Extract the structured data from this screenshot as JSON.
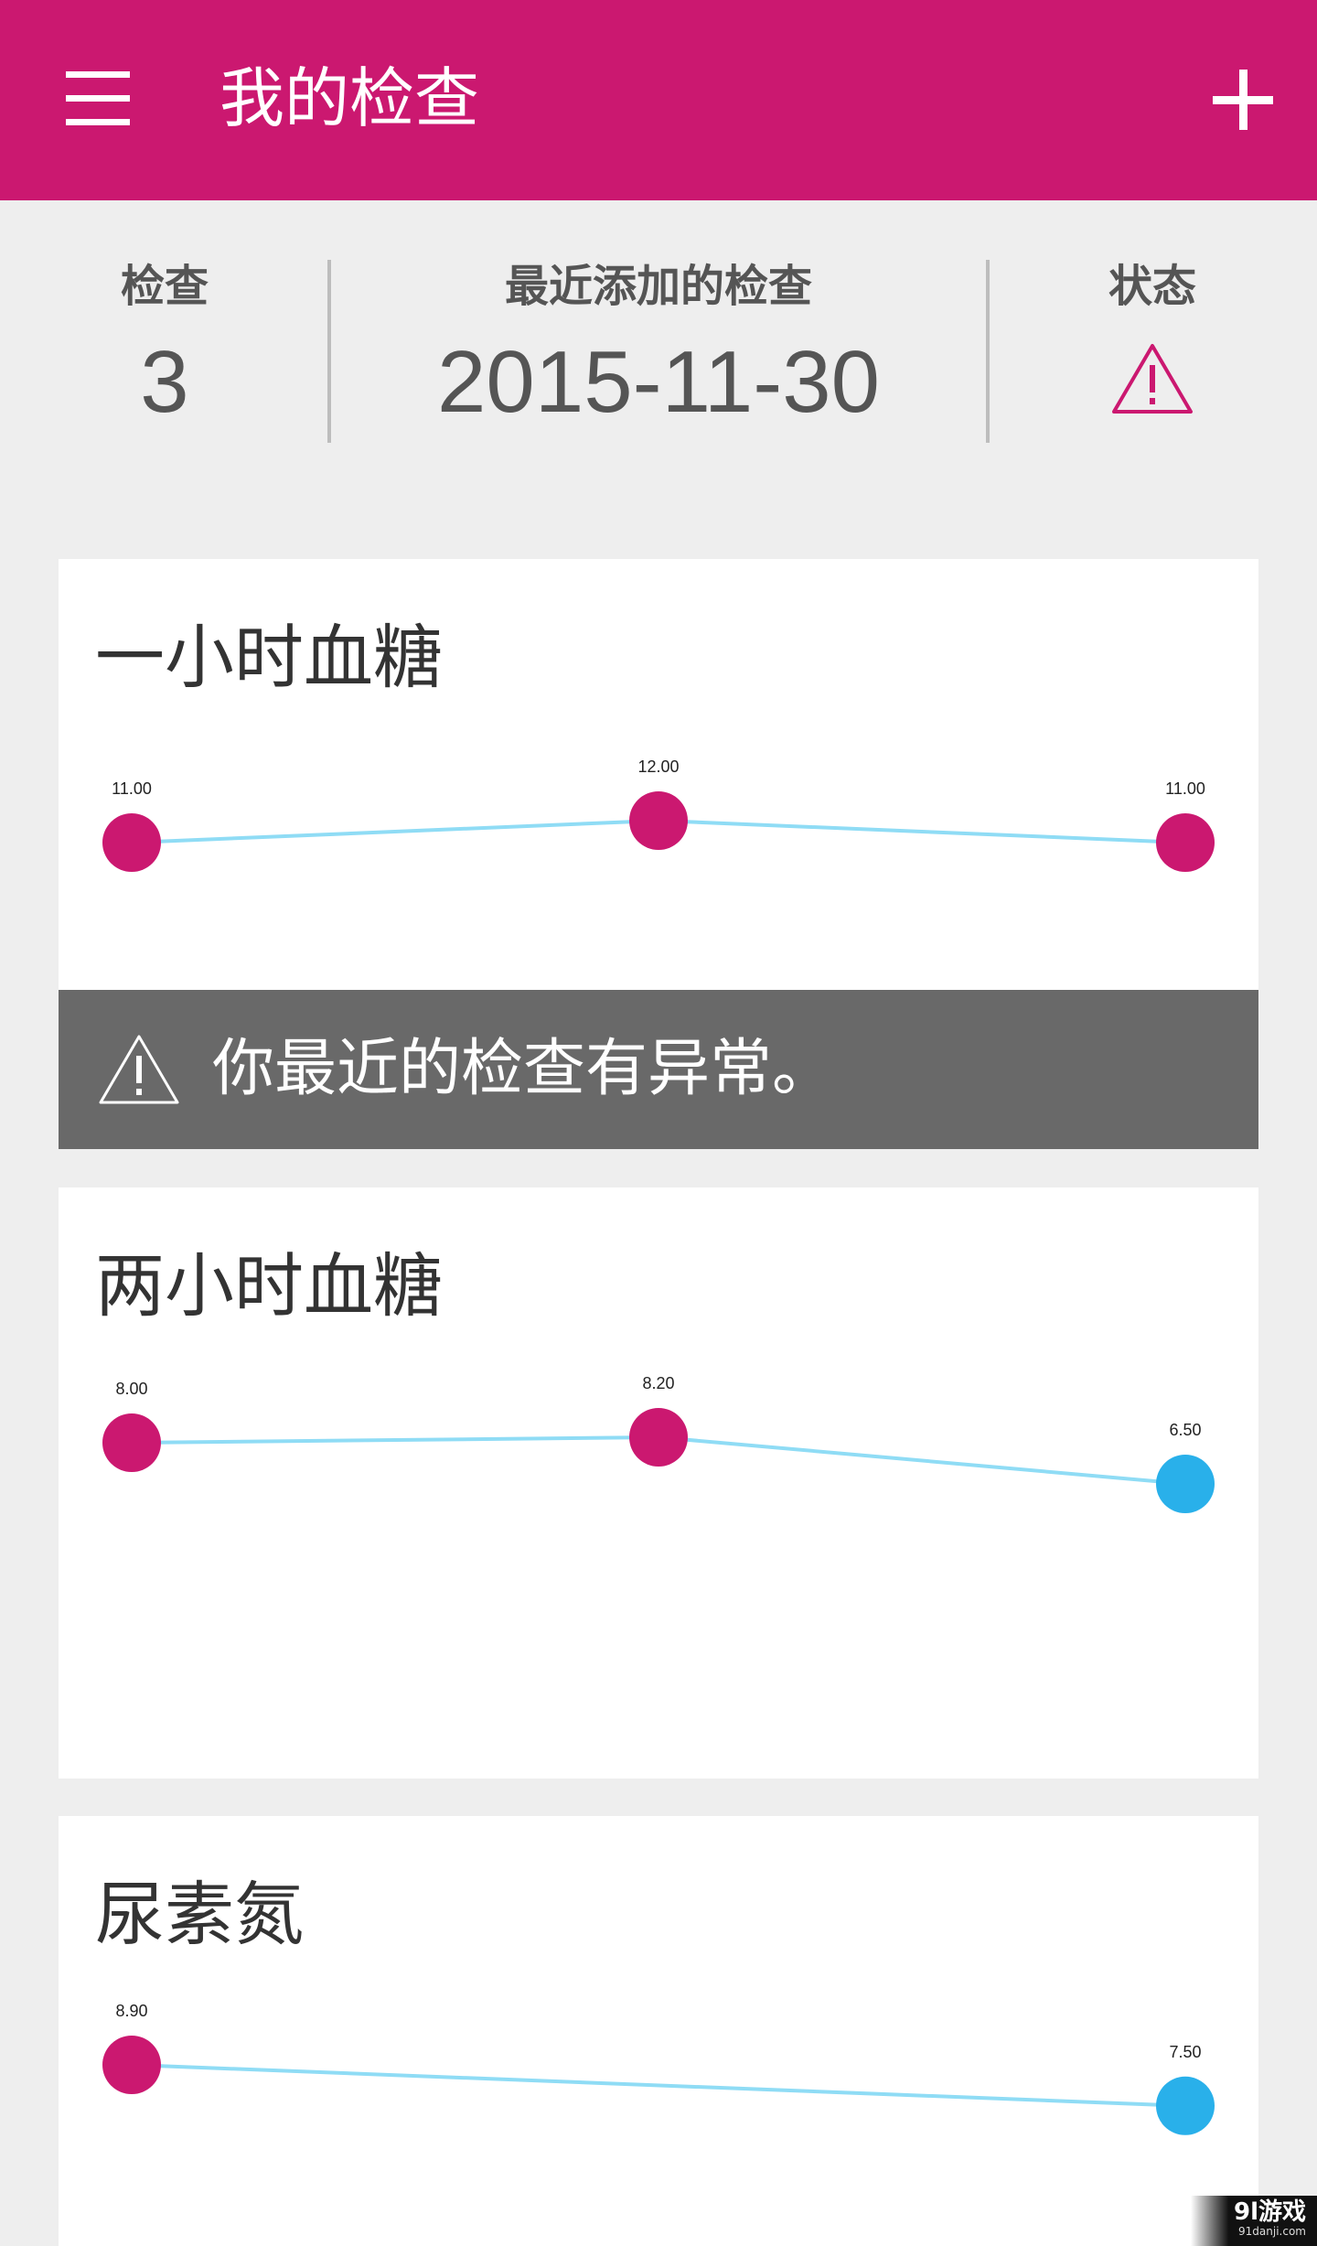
{
  "appbar": {
    "title": "我的检查",
    "background_color": "#cb1870",
    "menu_icon": "hamburger-menu-icon",
    "add_icon": "plus-icon"
  },
  "summary": {
    "checks_label": "检查",
    "checks_value": "3",
    "recent_label": "最近添加的检查",
    "recent_value": "2015-11-30",
    "status_label": "状态",
    "status_icon": "warning-triangle-icon",
    "status_color": "#cb1870"
  },
  "alert": {
    "icon": "warning-triangle-icon",
    "text": "你最近的检查有异常。",
    "background_color": "#696969"
  },
  "colors": {
    "abnormal_point": "#cb1870",
    "normal_point": "#29b0ea",
    "line": "#8fdcf5"
  },
  "cards": [
    {
      "title": "一小时血糖",
      "chart_data": {
        "type": "line",
        "series": [
          {
            "values": [
              11.0,
              12.0,
              11.0
            ],
            "labels": [
              "11.00",
              "12.00",
              "11.00"
            ],
            "status": [
              "abnormal",
              "abnormal",
              "abnormal"
            ]
          }
        ]
      }
    },
    {
      "title": "两小时血糖",
      "chart_data": {
        "type": "line",
        "series": [
          {
            "values": [
              8.0,
              8.2,
              6.5
            ],
            "labels": [
              "8.00",
              "8.20",
              "6.50"
            ],
            "status": [
              "abnormal",
              "abnormal",
              "normal"
            ]
          }
        ]
      }
    },
    {
      "title": "尿素氮",
      "chart_data": {
        "type": "line",
        "series": [
          {
            "values": [
              8.9,
              7.5
            ],
            "labels": [
              "8.90",
              "7.50"
            ],
            "status": [
              "abnormal",
              "normal"
            ]
          }
        ]
      }
    }
  ],
  "watermark": {
    "main": "9l游戏",
    "sub": "91danji.com"
  }
}
